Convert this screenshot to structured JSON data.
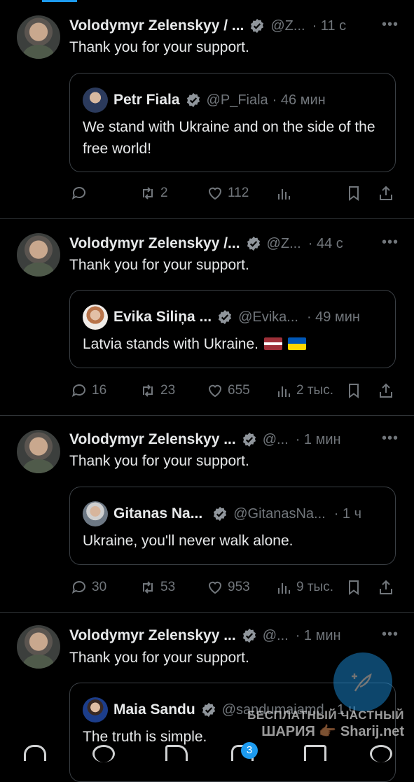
{
  "accent": "#1d9bf0",
  "tweets": [
    {
      "name": "Volodymyr Zelenskyy / ...",
      "handle": "@Z...",
      "time": "· 11 с",
      "text": "Thank you for your support.",
      "quote": {
        "name": "Petr Fiala",
        "handle": "@P_Fiala",
        "time": "· 46 мин",
        "text": "We stand with Ukraine and on the side of the free world!"
      },
      "stats": {
        "replies": "",
        "retweets": "2",
        "likes": "112",
        "views": ""
      }
    },
    {
      "name": "Volodymyr Zelenskyy /...",
      "handle": "@Z...",
      "time": "· 44 с",
      "text": "Thank you for your support.",
      "quote": {
        "name": "Evika Siliņa ...",
        "handle": "@Evika...",
        "time": "· 49 мин",
        "text": "Latvia stands with Ukraine."
      },
      "stats": {
        "replies": "16",
        "retweets": "23",
        "likes": "655",
        "views": "2 тыс."
      }
    },
    {
      "name": "Volodymyr Zelenskyy ...",
      "handle": "@...",
      "time": "· 1 мин",
      "text": "Thank you for your support.",
      "quote": {
        "name": "Gitanas Na...",
        "handle": "@GitanasNa...",
        "time": "· 1 ч",
        "text": "Ukraine, you'll never walk alone."
      },
      "stats": {
        "replies": "30",
        "retweets": "53",
        "likes": "953",
        "views": "9 тыс."
      }
    },
    {
      "name": "Volodymyr Zelenskyy ...",
      "handle": "@...",
      "time": "· 1 мин",
      "text": "Thank you for your support.",
      "quote": {
        "name": "Maia Sandu",
        "handle": "@sandumaiamd",
        "time": "· 1 ч",
        "text": "The truth is simple."
      }
    }
  ],
  "watermark": {
    "line1": "БЕСПЛАТНЫЙ ЧАСТНЫЙ",
    "line2": "ШАРИЯ 👉🏾 Sharij.net"
  },
  "nav": {
    "notifications_badge": "3"
  }
}
